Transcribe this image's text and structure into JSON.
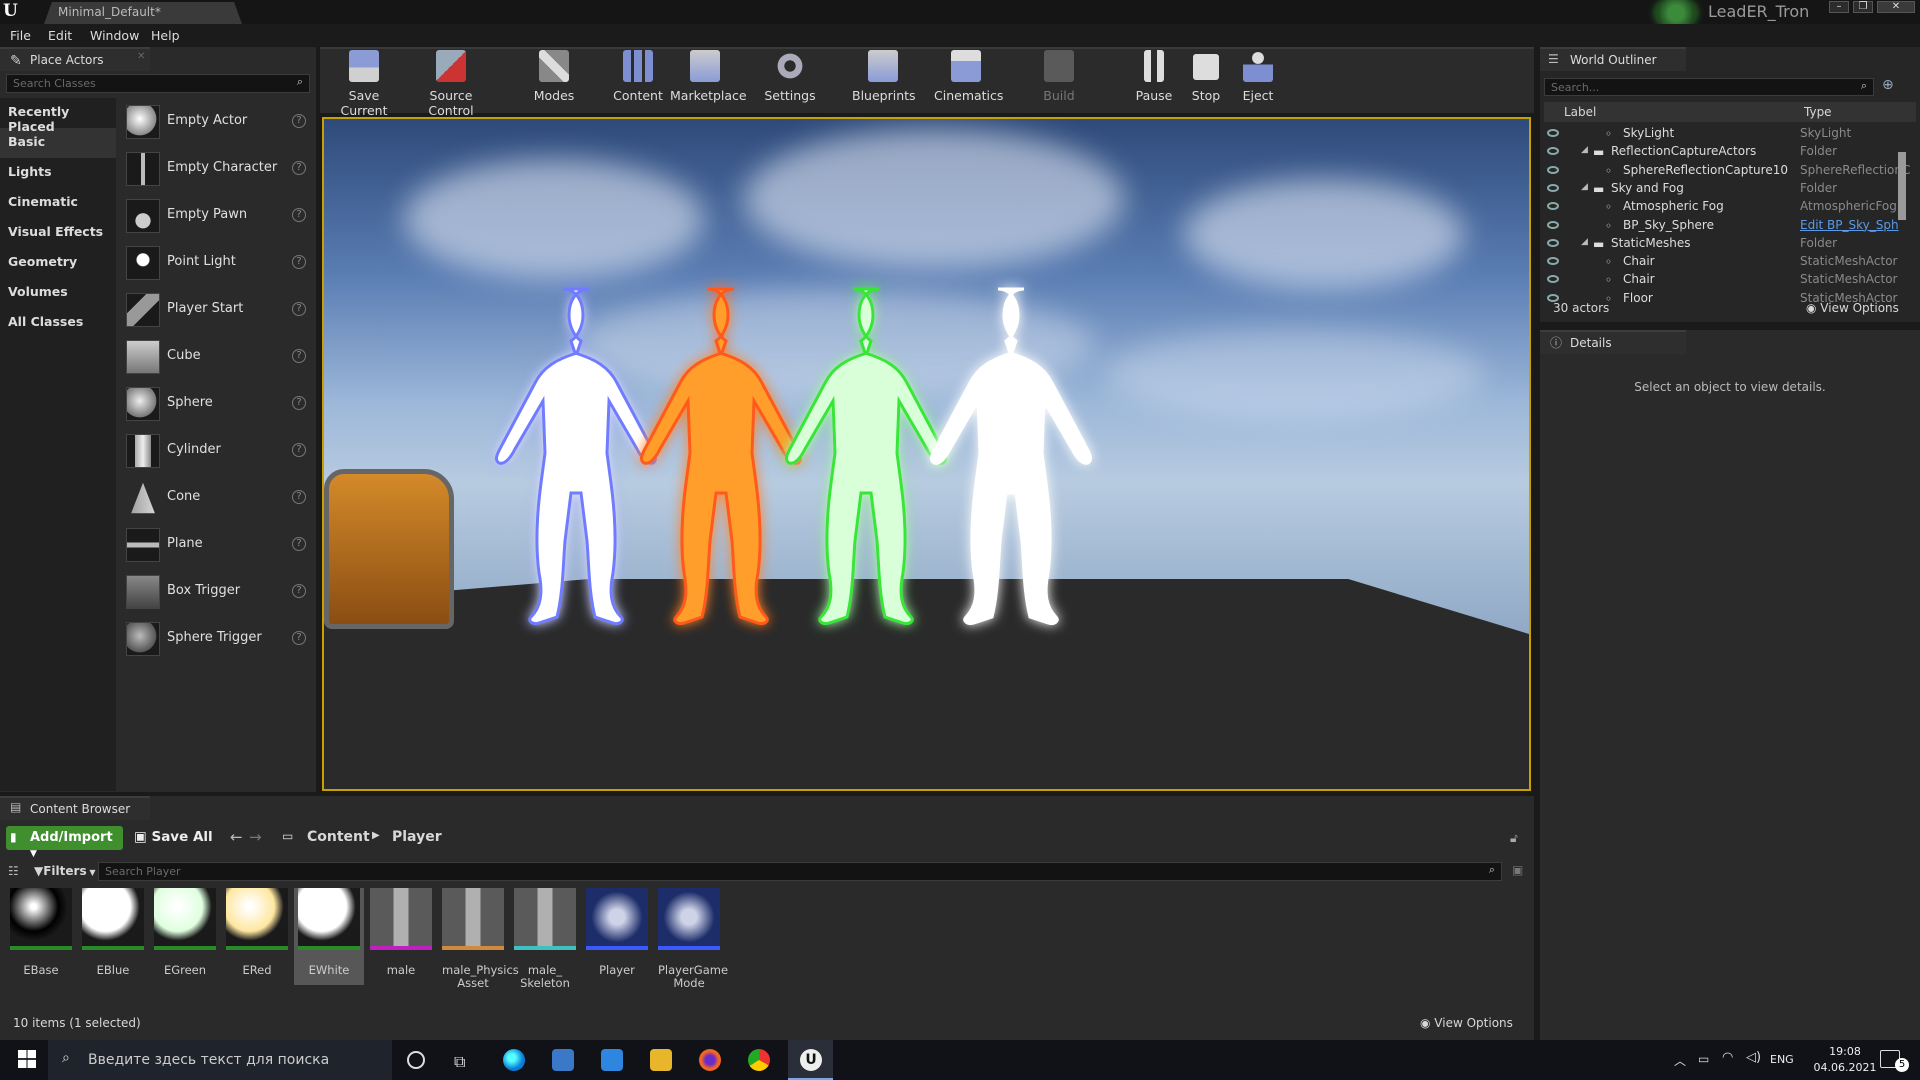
{
  "window": {
    "tab_title": "Minimal_Default*",
    "user_name": "LeadER_Tron",
    "minimize": "–",
    "maximize": "❐",
    "close": "✕"
  },
  "menu": [
    "File",
    "Edit",
    "Window",
    "Help"
  ],
  "place_actors": {
    "tab_label": "Place Actors",
    "search_placeholder": "Search Classes",
    "categories": [
      "Recently Placed",
      "Basic",
      "Lights",
      "Cinematic",
      "Visual Effects",
      "Geometry",
      "Volumes",
      "All Classes"
    ],
    "selected_category": "Basic",
    "actors": [
      "Empty Actor",
      "Empty Character",
      "Empty Pawn",
      "Point Light",
      "Player Start",
      "Cube",
      "Sphere",
      "Cylinder",
      "Cone",
      "Plane",
      "Box Trigger",
      "Sphere Trigger"
    ]
  },
  "toolbar": {
    "items": [
      "Save Current",
      "Source Control",
      "Modes",
      "Content",
      "Marketplace",
      "Settings",
      "Blueprints",
      "Cinematics",
      "Build",
      "Pause",
      "Stop",
      "Eject"
    ]
  },
  "viewport": {
    "figure_colors": [
      "#ffffff",
      "#ff9e2c",
      "#d9ffd9",
      "#ffffff"
    ],
    "glow_colors": [
      "#6f7cff",
      "#ff5a1a",
      "#39e639",
      "#ffffff"
    ]
  },
  "world_outliner": {
    "tab_label": "World Outliner",
    "search_placeholder": "Search...",
    "col_label": "Label",
    "col_type": "Type",
    "rows": [
      {
        "label": "SkyLight",
        "type": "SkyLight",
        "indent": 2,
        "icon": "light-icon"
      },
      {
        "label": "ReflectionCaptureActors",
        "type": "Folder",
        "indent": 1,
        "icon": "folder-icon"
      },
      {
        "label": "SphereReflectionCapture10",
        "type": "SphereReflectionC",
        "indent": 2,
        "icon": "capture-icon"
      },
      {
        "label": "Sky and Fog",
        "type": "Folder",
        "indent": 1,
        "icon": "folder-icon"
      },
      {
        "label": "Atmospheric Fog",
        "type": "AtmosphericFog",
        "indent": 2,
        "icon": "fog-icon"
      },
      {
        "label": "BP_Sky_Sphere",
        "type": "Edit BP_Sky_Sph",
        "indent": 2,
        "icon": "sphere-icon"
      },
      {
        "label": "StaticMeshes",
        "type": "Folder",
        "indent": 1,
        "icon": "folder-icon"
      },
      {
        "label": "Chair",
        "type": "StaticMeshActor",
        "indent": 2,
        "icon": "mesh-icon"
      },
      {
        "label": "Chair",
        "type": "StaticMeshActor",
        "indent": 2,
        "icon": "mesh-icon"
      },
      {
        "label": "Floor",
        "type": "StaticMeshActor",
        "indent": 2,
        "icon": "mesh-icon"
      }
    ],
    "actor_count": "30 actors",
    "view_options": "View Options"
  },
  "details": {
    "tab_label": "Details",
    "empty_text": "Select an object to view details."
  },
  "content_browser": {
    "tab_label": "Content Browser",
    "add_import": "Add/Import",
    "save_all": "Save All",
    "path": [
      "Content",
      "Player"
    ],
    "filters": "Filters",
    "search_placeholder": "Search Player",
    "assets": [
      {
        "name": "EBase",
        "kind": "material",
        "color": "#000000",
        "bar": "#2a8a2a"
      },
      {
        "name": "EBlue",
        "kind": "material",
        "color": "#ffffff",
        "bar": "#2a8a2a"
      },
      {
        "name": "EGreen",
        "kind": "material",
        "color": "#dfffdf",
        "bar": "#2a8a2a"
      },
      {
        "name": "ERed",
        "kind": "material",
        "color": "#ffe7a0",
        "bar": "#2a8a2a"
      },
      {
        "name": "EWhite",
        "kind": "material",
        "color": "#ffffff",
        "bar": "#2a8a2a"
      },
      {
        "name": "male",
        "kind": "mesh",
        "color": "#777777",
        "bar": "#c020c0"
      },
      {
        "name": "male_Physics Asset",
        "kind": "mesh",
        "color": "#777777",
        "bar": "#d08a40"
      },
      {
        "name": "male_ Skeleton",
        "kind": "skeleton",
        "color": "#777777",
        "bar": "#40c0c0"
      },
      {
        "name": "Player",
        "kind": "blueprint",
        "color": "#1c2d6a",
        "bar": "#3a5aff"
      },
      {
        "name": "PlayerGame Mode",
        "kind": "blueprint",
        "color": "#1c2d6a",
        "bar": "#3a5aff"
      }
    ],
    "selected_asset": "EWhite",
    "status": "10 items (1 selected)",
    "view_options": "View Options"
  },
  "taskbar": {
    "search_placeholder": "Введите здесь текст для поиска",
    "language": "ENG",
    "time": "19:08",
    "date": "04.06.2021",
    "notifications": "5"
  }
}
